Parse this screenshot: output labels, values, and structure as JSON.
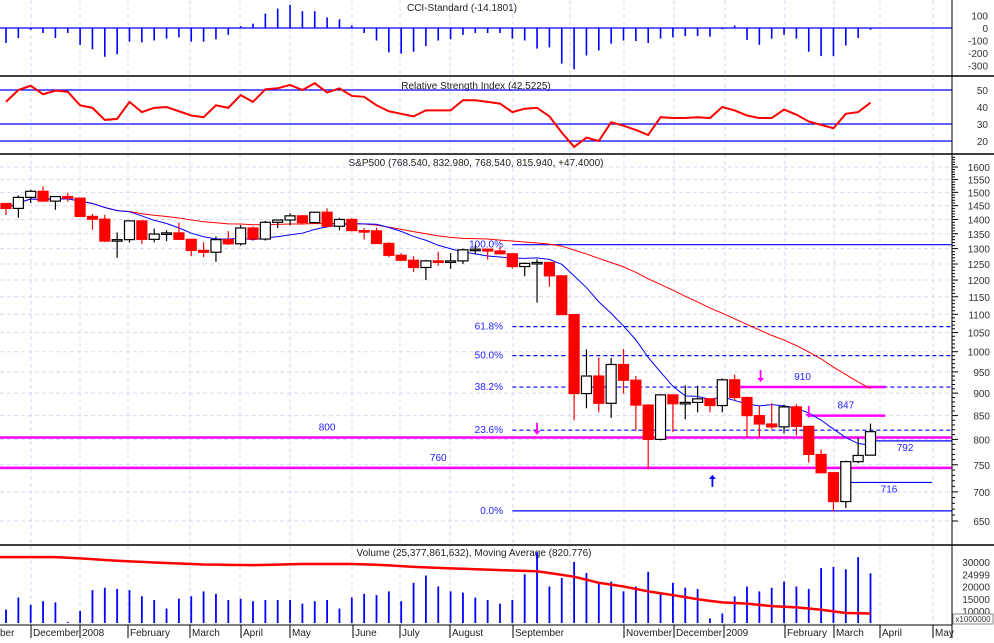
{
  "colors": {
    "up_border": "#000000",
    "down": "#ff0000",
    "ma_fast": "#0000ff",
    "ma_slow": "#ff0000",
    "fib": "#0000ff",
    "support": "#ff00ff",
    "grid": "#d8d8f0",
    "cci": "#0000ff",
    "rsi": "#ff0000",
    "volume": "#0000ff",
    "volume_ma": "#ff0000"
  },
  "chart_data": [
    {
      "type": "bar",
      "name": "cci",
      "title": "CCI-Standard (-14.1801)",
      "ylim": [
        -360,
        180
      ],
      "yticks": [
        "100",
        "0",
        "-100",
        "-200",
        "-300"
      ],
      "values": [
        -120,
        -80,
        -15,
        -40,
        -80,
        -40,
        -135,
        -170,
        -230,
        -210,
        -110,
        -115,
        -100,
        -85,
        -75,
        -110,
        -110,
        -90,
        -55,
        15,
        35,
        115,
        155,
        185,
        135,
        135,
        85,
        70,
        20,
        -40,
        -100,
        -195,
        -205,
        -190,
        -145,
        -100,
        -90,
        -55,
        -40,
        -40,
        -40,
        -85,
        -100,
        -165,
        -155,
        -285,
        -330,
        -220,
        -180,
        -125,
        -100,
        -105,
        -120,
        -85,
        -75,
        -65,
        -65,
        -70,
        -10,
        20,
        -95,
        -135,
        -85,
        -55,
        -85,
        -190,
        -225,
        -225,
        -140,
        -80,
        -14.18
      ]
    },
    {
      "type": "line",
      "name": "rsi",
      "title": "Relative Strength Index (42.5225)",
      "ylim": [
        12,
        57
      ],
      "yticks": [
        "50",
        "40",
        "30",
        "20"
      ],
      "reference_lines": [
        50,
        30,
        20
      ],
      "values": [
        43,
        50,
        52.5,
        47.5,
        49.6,
        49,
        41,
        39.5,
        32.4,
        33,
        43,
        37,
        39.5,
        40,
        37.5,
        35,
        34,
        41,
        39.5,
        47,
        43,
        50.4,
        51,
        53,
        50,
        54,
        48.5,
        51,
        46.5,
        46,
        41,
        37.5,
        36,
        34.5,
        38,
        38,
        38,
        44,
        44,
        43,
        42,
        37,
        39,
        39.5,
        34.5,
        25,
        16.5,
        22,
        20,
        31,
        29,
        26.5,
        23.5,
        34,
        33.5,
        33.5,
        34,
        33.5,
        40,
        38,
        35,
        33.5,
        33.5,
        38.5,
        35.5,
        31.5,
        29.5,
        27.5,
        36,
        37,
        42.52
      ]
    },
    {
      "type": "candlestick",
      "name": "price",
      "title": "S&P500 (768.540, 832.980, 768.540, 815.940, +47.4000)",
      "scale": "log",
      "ylim": [
        620,
        1660
      ],
      "yticks": [
        "1600",
        "1550",
        "1500",
        "1450",
        "1400",
        "1350",
        "1300",
        "1250",
        "1200",
        "1150",
        "1100",
        "1050",
        "1000",
        "950",
        "900",
        "850",
        "800",
        "750",
        "700",
        "650"
      ],
      "ma_periods": {
        "fast": 10,
        "slow": 30
      },
      "ohlc": [
        [
          1458,
          1460,
          1416,
          1440
        ],
        [
          1440,
          1488,
          1406,
          1481
        ],
        [
          1481,
          1510,
          1460,
          1504
        ],
        [
          1504,
          1523,
          1467,
          1467
        ],
        [
          1467,
          1486,
          1435,
          1484
        ],
        [
          1484,
          1499,
          1465,
          1478
        ],
        [
          1478,
          1478,
          1411,
          1411
        ],
        [
          1411,
          1420,
          1364,
          1401
        ],
        [
          1401,
          1417,
          1322,
          1325
        ],
        [
          1325,
          1355,
          1270,
          1330
        ],
        [
          1330,
          1396,
          1320,
          1395
        ],
        [
          1395,
          1396,
          1316,
          1331
        ],
        [
          1331,
          1368,
          1321,
          1349
        ],
        [
          1349,
          1362,
          1325,
          1353
        ],
        [
          1353,
          1389,
          1330,
          1331
        ],
        [
          1331,
          1332,
          1275,
          1294
        ],
        [
          1294,
          1321,
          1272,
          1288
        ],
        [
          1288,
          1341,
          1257,
          1330
        ],
        [
          1330,
          1359,
          1312,
          1316
        ],
        [
          1316,
          1380,
          1310,
          1370
        ],
        [
          1370,
          1375,
          1332,
          1332
        ],
        [
          1332,
          1395,
          1327,
          1390
        ],
        [
          1390,
          1400,
          1370,
          1398
        ],
        [
          1398,
          1422,
          1380,
          1413
        ],
        [
          1413,
          1416,
          1382,
          1389
        ],
        [
          1389,
          1426,
          1385,
          1426
        ],
        [
          1426,
          1440,
          1373,
          1376
        ],
        [
          1376,
          1406,
          1362,
          1400
        ],
        [
          1400,
          1405,
          1358,
          1361
        ],
        [
          1361,
          1370,
          1330,
          1360
        ],
        [
          1360,
          1371,
          1317,
          1317
        ],
        [
          1317,
          1322,
          1272,
          1278
        ],
        [
          1278,
          1285,
          1260,
          1262
        ],
        [
          1262,
          1275,
          1225,
          1239
        ],
        [
          1239,
          1263,
          1200,
          1260
        ],
        [
          1260,
          1290,
          1245,
          1257
        ],
        [
          1257,
          1285,
          1235,
          1260
        ],
        [
          1260,
          1300,
          1250,
          1296
        ],
        [
          1296,
          1313,
          1280,
          1298
        ],
        [
          1298,
          1300,
          1264,
          1292
        ],
        [
          1292,
          1305,
          1281,
          1283
        ],
        [
          1283,
          1285,
          1236,
          1242
        ],
        [
          1242,
          1255,
          1212,
          1252
        ],
        [
          1252,
          1265,
          1133,
          1255
        ],
        [
          1255,
          1255,
          1180,
          1213
        ],
        [
          1213,
          1215,
          1099,
          1099
        ],
        [
          1099,
          1100,
          840,
          899
        ],
        [
          899,
          1006,
          866,
          940
        ],
        [
          940,
          985,
          857,
          877
        ],
        [
          877,
          984,
          845,
          968
        ],
        [
          968,
          1007,
          899,
          930
        ],
        [
          930,
          940,
          818,
          873
        ],
        [
          873,
          875,
          741,
          800
        ],
        [
          800,
          896,
          798,
          896
        ],
        [
          896,
          897,
          815,
          876
        ],
        [
          876,
          918,
          842,
          879
        ],
        [
          879,
          917,
          857,
          887
        ],
        [
          887,
          887,
          857,
          872
        ],
        [
          872,
          934,
          857,
          931
        ],
        [
          931,
          943,
          884,
          890
        ],
        [
          890,
          892,
          805,
          850
        ],
        [
          850,
          871,
          804,
          832
        ],
        [
          832,
          877,
          821,
          826
        ],
        [
          826,
          874,
          812,
          869
        ],
        [
          869,
          875,
          808,
          827
        ],
        [
          827,
          828,
          754,
          770
        ],
        [
          770,
          780,
          734,
          735
        ],
        [
          735,
          736,
          666,
          683
        ],
        [
          683,
          758,
          672,
          756
        ],
        [
          756,
          804,
          753,
          768
        ],
        [
          768.54,
          832.98,
          768.54,
          815.94
        ]
      ],
      "fibonacci": {
        "start_index": 41,
        "levels": [
          {
            "label": "100.0%",
            "price": 1313,
            "style": "solid"
          },
          {
            "label": "61.8%",
            "price": 1066,
            "style": "dashed"
          },
          {
            "label": "50.0%",
            "price": 990,
            "style": "dashed"
          },
          {
            "label": "38.2%",
            "price": 914,
            "style": "dashed"
          },
          {
            "label": "23.6%",
            "price": 819,
            "style": "dashed"
          },
          {
            "label": "0.0%",
            "price": 667,
            "style": "solid"
          }
        ]
      },
      "horizontal_lines": [
        {
          "label": "800",
          "price": 804,
          "from": -1,
          "to": 78,
          "color": "support",
          "label_index": 26
        },
        {
          "label": "760",
          "price": 744,
          "from": -1,
          "to": 78,
          "color": "support",
          "label_index": 35
        },
        {
          "label": "910",
          "price": 914,
          "from": 59,
          "to": 71.2,
          "color": "support",
          "label_index": 64.5
        },
        {
          "label": "847",
          "price": 850,
          "from": 65.1,
          "to": 71.2,
          "color": "support",
          "label_index": 68
        },
        {
          "label": "792",
          "price": 797,
          "from": 70.2,
          "to": 78,
          "color": "fib",
          "label_index": 72.8
        },
        {
          "label": "716",
          "price": 717,
          "from": 68.1,
          "to": 75,
          "color": "fib",
          "label_index": 71.5
        }
      ],
      "arrows": [
        {
          "index": 43,
          "price": 822,
          "direction": "down",
          "color": "support"
        },
        {
          "index": 61.1,
          "price": 940,
          "direction": "down",
          "color": "support"
        },
        {
          "index": 65,
          "price": 858,
          "direction": "down",
          "color": "support"
        },
        {
          "index": 57.2,
          "price": 720,
          "direction": "up",
          "color": "fib"
        }
      ]
    },
    {
      "type": "bar",
      "name": "volume",
      "title": "Volume (25,377,861,632), Moving Average (820.776)",
      "yticks": [
        "30000",
        "24999",
        "20000",
        "15000",
        "10000"
      ],
      "unit_label": "x1000000",
      "values": [
        10600,
        15500,
        12500,
        14000,
        13500,
        5500,
        10000,
        18500,
        19500,
        19000,
        18500,
        16000,
        14500,
        11000,
        15000,
        16000,
        18000,
        17000,
        14500,
        15000,
        14000,
        14500,
        14500,
        14500,
        13000,
        14000,
        14500,
        11000,
        15500,
        17000,
        16500,
        18000,
        14000,
        21500,
        24500,
        20000,
        18000,
        17500,
        15500,
        14500,
        13000,
        14500,
        25000,
        34000,
        20000,
        23500,
        30000,
        25500,
        21500,
        22000,
        18000,
        20000,
        26000,
        17000,
        21500,
        19500,
        19000,
        7000,
        9000,
        16000,
        20000,
        18000,
        19500,
        22000,
        20000,
        19000,
        27500,
        28000,
        27000,
        32000,
        25377
      ],
      "moving_average_keypoints": [
        [
          0,
          32000
        ],
        [
          4,
          32000
        ],
        [
          6,
          31500
        ],
        [
          9,
          30500
        ],
        [
          12,
          29800
        ],
        [
          16,
          29000
        ],
        [
          20,
          28700
        ],
        [
          24,
          29200
        ],
        [
          28,
          29200
        ],
        [
          30,
          28900
        ],
        [
          33,
          28000
        ],
        [
          36,
          27400
        ],
        [
          40,
          26700
        ],
        [
          43,
          26200
        ],
        [
          44,
          25500
        ],
        [
          46,
          24000
        ],
        [
          48,
          21500
        ],
        [
          50,
          20000
        ],
        [
          52,
          18000
        ],
        [
          54,
          16500
        ],
        [
          56,
          14800
        ],
        [
          58,
          13500
        ],
        [
          60,
          13000
        ],
        [
          62,
          12000
        ],
        [
          64,
          11500
        ],
        [
          66,
          10500
        ],
        [
          68,
          9200
        ],
        [
          70,
          9000
        ]
      ]
    }
  ],
  "x_axis": {
    "labels": [
      "ber",
      "December",
      "2008",
      "February",
      "March",
      "April",
      "May",
      "June",
      "July",
      "August",
      "September",
      "November",
      "December",
      "2009",
      "February",
      "March",
      "April",
      "May"
    ]
  }
}
